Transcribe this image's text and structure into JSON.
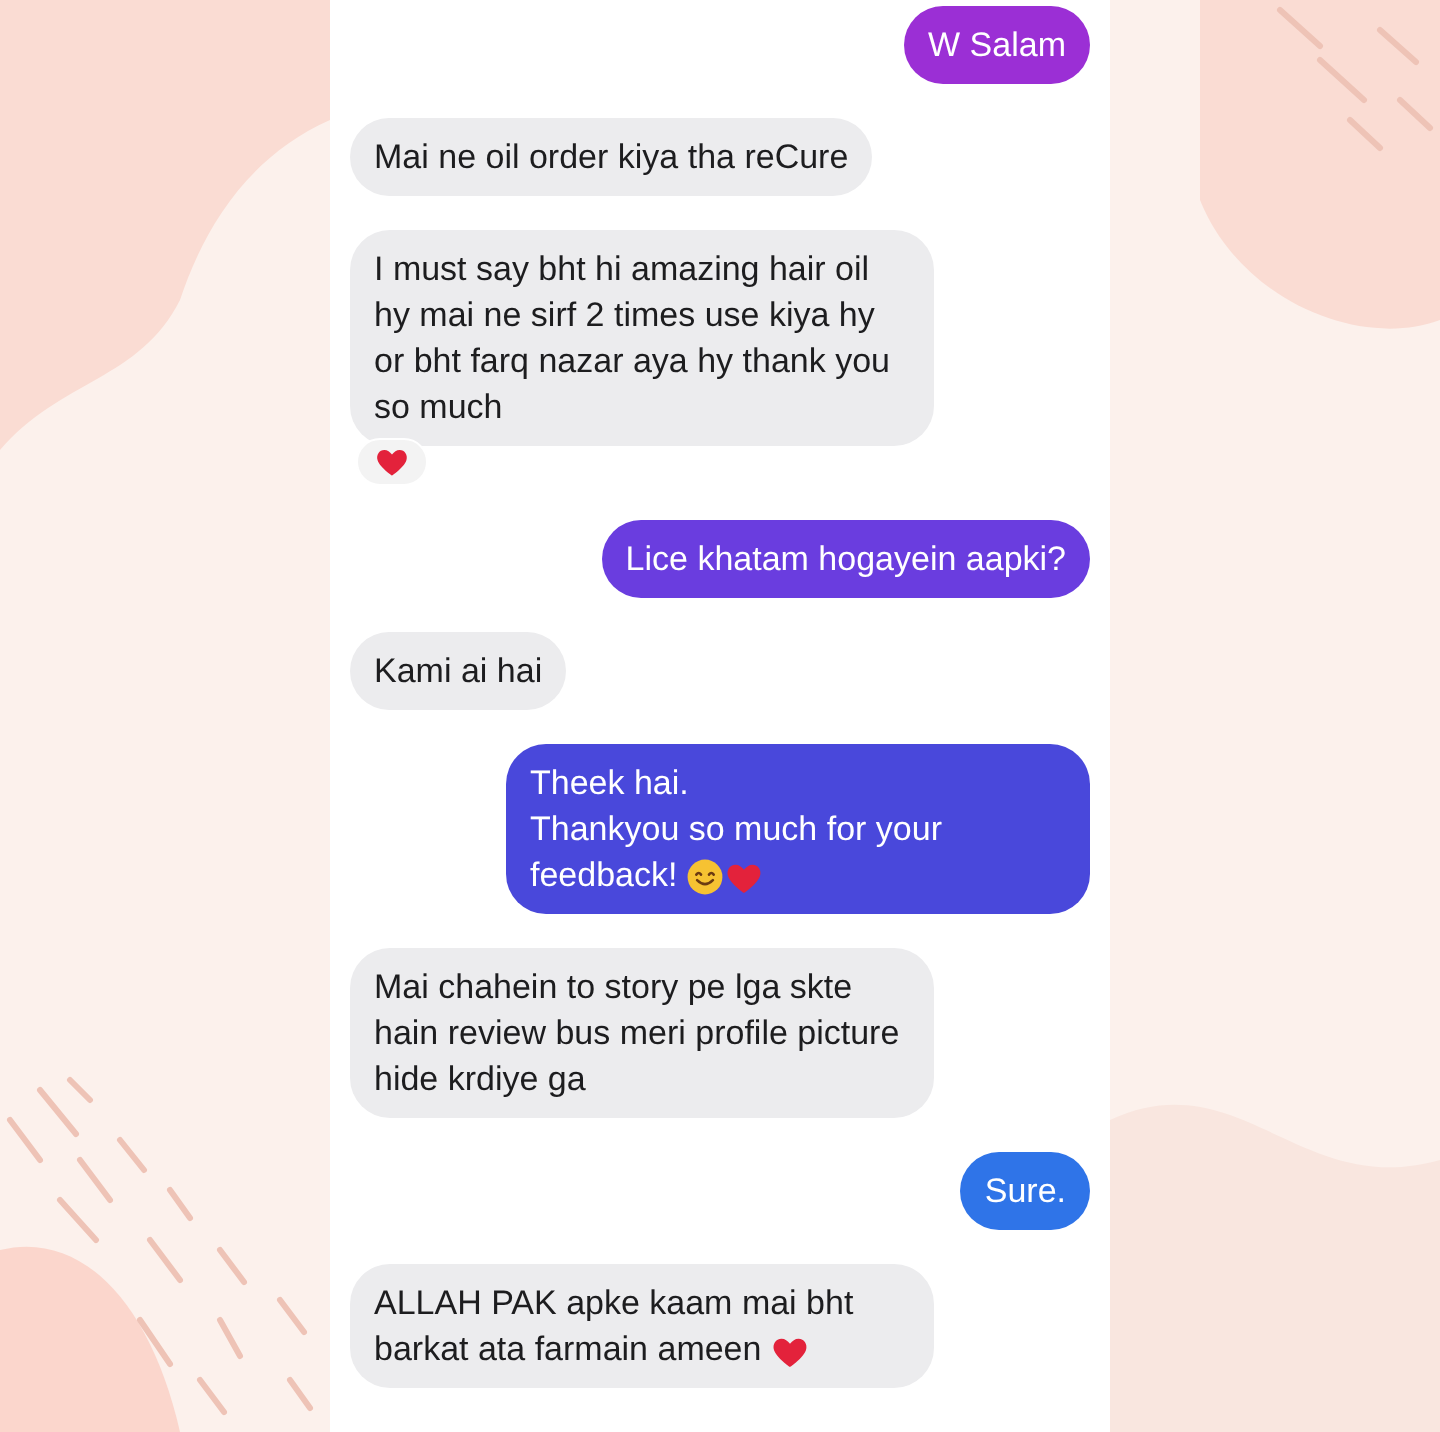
{
  "messages": [
    {
      "kind": "sent",
      "text": "W Salam",
      "color": "#9b2fd5"
    },
    {
      "kind": "received",
      "text": "Mai ne oil order kiya tha reCure"
    },
    {
      "kind": "received",
      "text": "I must say bht hi amazing hair oil hy mai ne sirf 2 times use kiya hy or bht farq nazar aya hy thank you so much",
      "heart_reaction": true
    },
    {
      "kind": "sent",
      "text": "Lice khatam hogayein aapki?",
      "color": "#6a3ddf"
    },
    {
      "kind": "received",
      "text": "Kami ai hai"
    },
    {
      "kind": "sent",
      "text": "Theek hai.\nThankyou so much for your feedback!",
      "color": "#4948db",
      "smile_emoji": true,
      "heart_emoji": true
    },
    {
      "kind": "received",
      "text": "Mai chahein to story pe lga skte hain review bus meri profile picture hide krdiye ga"
    },
    {
      "kind": "sent",
      "text": "Sure.",
      "color": "#2f74e8"
    },
    {
      "kind": "received",
      "text": "ALLAH PAK apke kaam mai bht barkat ata farmain ameen",
      "heart_emoji": true
    }
  ]
}
